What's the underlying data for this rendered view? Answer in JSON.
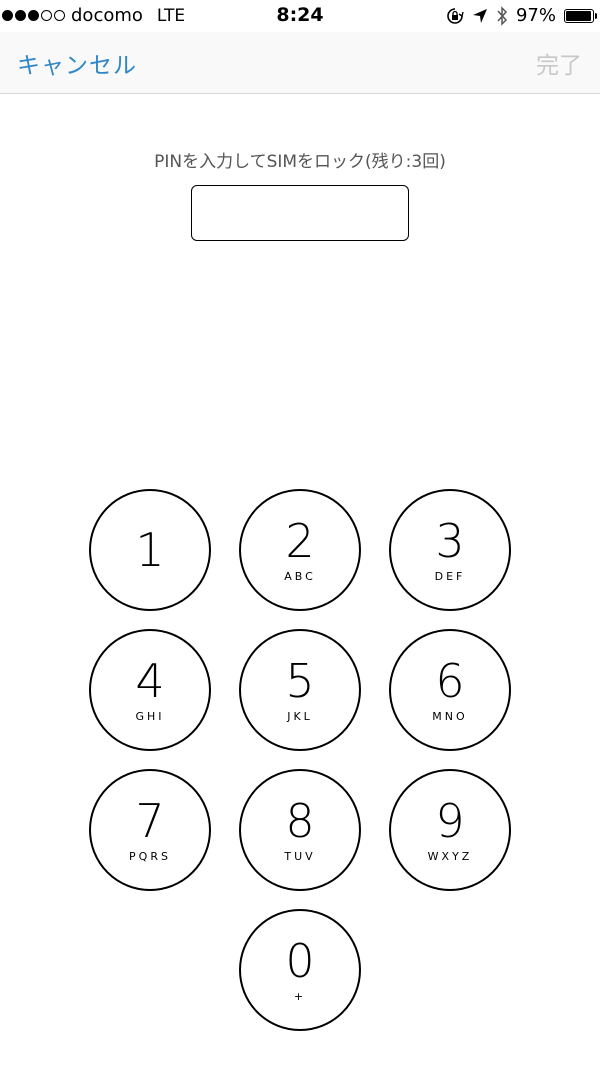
{
  "status_bar": {
    "carrier": "docomo",
    "network": "LTE",
    "time": "8:24",
    "battery": "97%",
    "battery_level": 0.97
  },
  "nav": {
    "cancel_label": "キャンセル",
    "done_label": "完了"
  },
  "prompt": "PINを入力してSIMをロック(残り:3回)",
  "pin_value": "",
  "keys": [
    {
      "num": "1",
      "letters": ""
    },
    {
      "num": "2",
      "letters": "ABC"
    },
    {
      "num": "3",
      "letters": "DEF"
    },
    {
      "num": "4",
      "letters": "GHI"
    },
    {
      "num": "5",
      "letters": "JKL"
    },
    {
      "num": "6",
      "letters": "MNO"
    },
    {
      "num": "7",
      "letters": "PQRS"
    },
    {
      "num": "8",
      "letters": "TUV"
    },
    {
      "num": "9",
      "letters": "WXYZ"
    },
    {
      "num": "0",
      "letters": "+"
    }
  ],
  "colors": {
    "accent": "#2f87c8",
    "disabled": "#c8c8c8"
  },
  "icons": [
    "orientation-lock-icon",
    "location-icon",
    "bluetooth-icon",
    "battery-icon"
  ]
}
